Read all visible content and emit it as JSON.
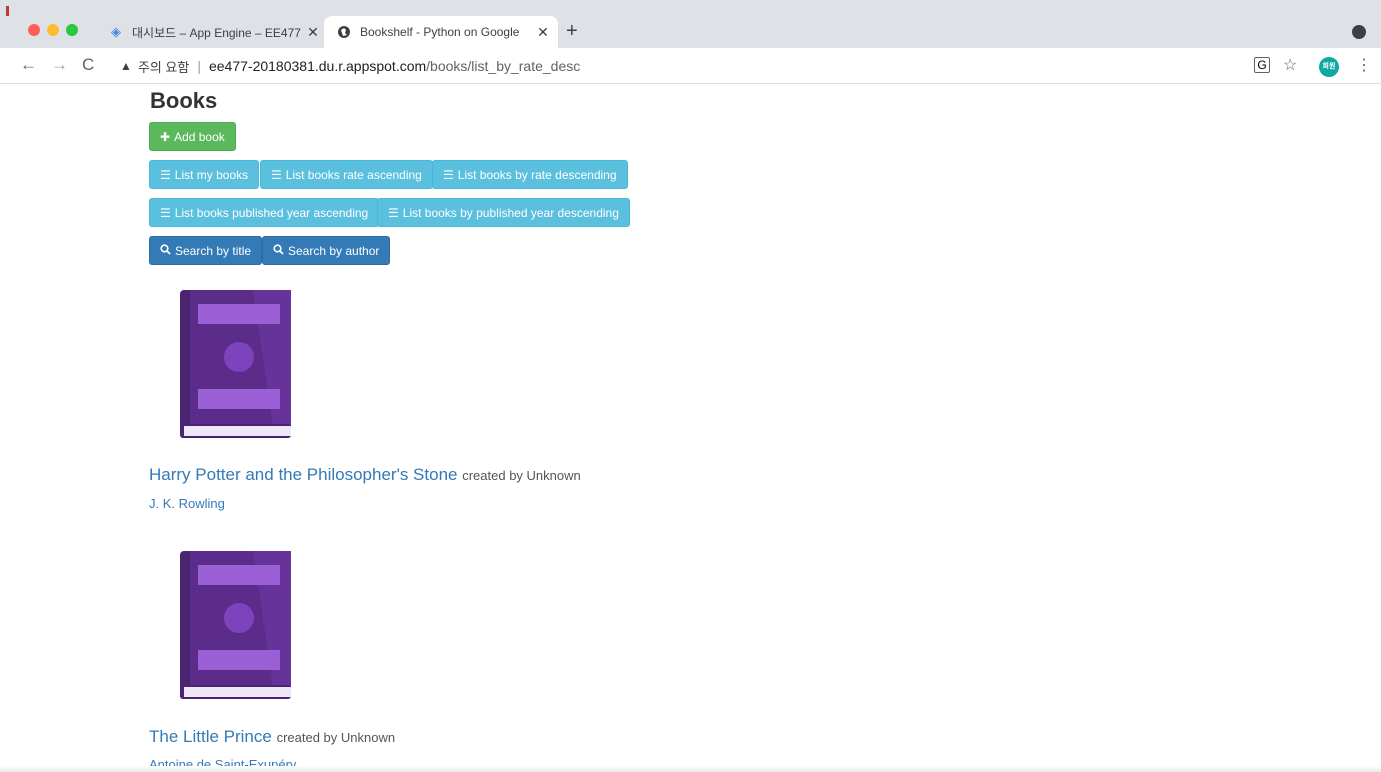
{
  "browser": {
    "tabs": [
      {
        "title": "대시보드 – App Engine – EE477",
        "favicon": "app-engine-icon",
        "close": "✕"
      },
      {
        "title": "Bookshelf - Python on Google",
        "favicon": "globe-icon",
        "close": "✕"
      }
    ],
    "new_tab": "+",
    "address": {
      "warning": "주의 요함",
      "host": "ee477-20180381.du.r.appspot.com",
      "path": "/books/list_by_rate_desc"
    },
    "avatar_text": "희원"
  },
  "page": {
    "title": "Books",
    "buttons": {
      "add_book": "Add book",
      "list_my_books": "List my books",
      "list_rate_asc": "List books rate ascending",
      "list_rate_desc": "List books by rate descending",
      "list_year_asc": "List books published year ascending",
      "list_year_desc": "List books by published year descending",
      "search_title": "Search by title",
      "search_author": "Search by author"
    },
    "books": [
      {
        "title": "Harry Potter and the Philosopher's Stone",
        "created_by": "created by Unknown",
        "author": "J. K. Rowling"
      },
      {
        "title": "The Little Prince",
        "created_by": "created by Unknown",
        "author": "Antoine de Saint-Exupéry"
      }
    ]
  },
  "colors": {
    "success": "#5cb85c",
    "info": "#5bc0de",
    "primary": "#337ab7",
    "book_purple": "#4a2470"
  }
}
